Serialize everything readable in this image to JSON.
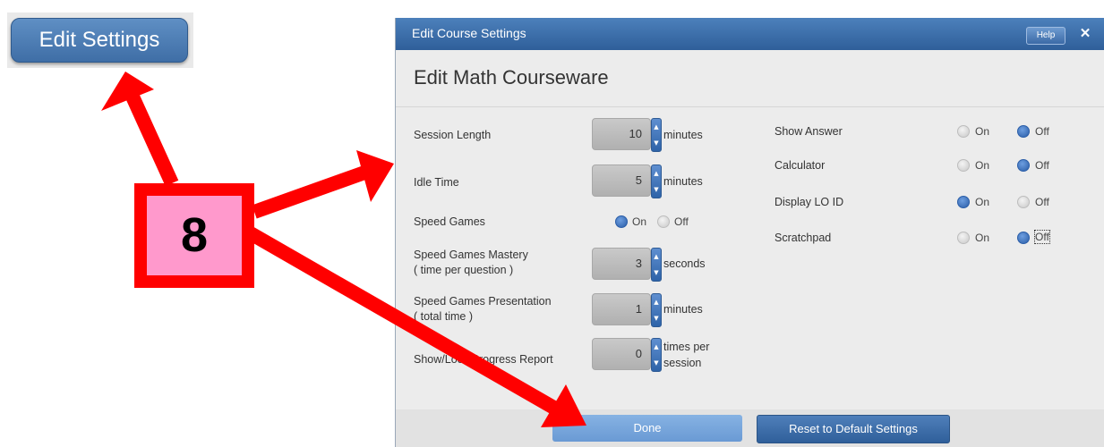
{
  "edit_settings_button": "Edit Settings",
  "dialog": {
    "title": "Edit Course Settings",
    "help_label": "Help",
    "close_glyph": "✕",
    "heading": "Edit Math Courseware"
  },
  "left_settings": [
    {
      "label": "Session Length",
      "value": "10",
      "unit": "minutes"
    },
    {
      "label": "Idle Time",
      "value": "5",
      "unit": "minutes"
    },
    {
      "label": "Speed Games Mastery",
      "label2": "( time per question )",
      "value": "3",
      "unit": "seconds"
    },
    {
      "label": "Speed Games Presentation",
      "label2": "( total time )",
      "value": "1",
      "unit": "minutes"
    },
    {
      "label": "Show/Lock Progress Report",
      "value": "0",
      "unit": "times per",
      "unit2": "session"
    }
  ],
  "speed_games": {
    "label": "Speed Games",
    "on": "On",
    "off": "Off",
    "selected": "On"
  },
  "right_settings": [
    {
      "label": "Show Answer",
      "on": "On",
      "off": "Off",
      "selected": "Off"
    },
    {
      "label": "Calculator",
      "on": "On",
      "off": "Off",
      "selected": "Off"
    },
    {
      "label": "Display LO ID",
      "on": "On",
      "off": "Off",
      "selected": "On"
    },
    {
      "label": "Scratchpad",
      "on": "On",
      "off": "Off",
      "selected": "Off"
    }
  ],
  "footer": {
    "done_label": "Done",
    "reset_label": "Reset to Default Settings"
  },
  "annotation": {
    "step_number": "8",
    "color": "#ff0000",
    "fill": "#ff99cc"
  },
  "colors": {
    "titlebar": "#3a6ba8",
    "accent": "#2b5ea8"
  }
}
